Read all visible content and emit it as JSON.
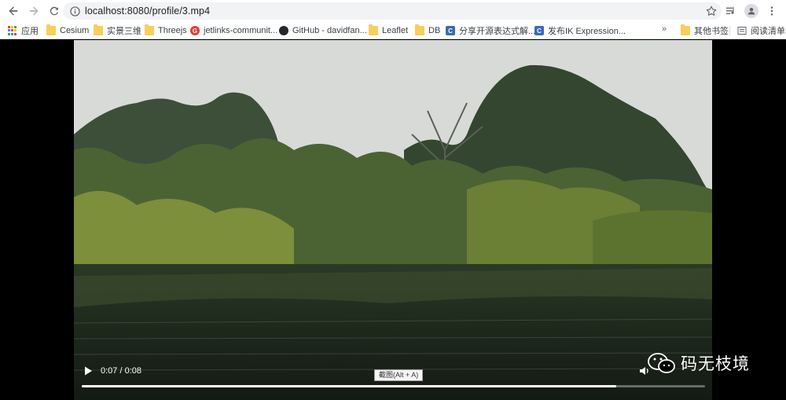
{
  "browser": {
    "url": "localhost:8080/profile/3.mp4"
  },
  "bookmarks": {
    "items": [
      {
        "label": "应用",
        "icon": "apps-icon"
      },
      {
        "label": "Cesium",
        "icon": "folder-icon"
      },
      {
        "label": "实景三维",
        "icon": "folder-icon"
      },
      {
        "label": "Threejs",
        "icon": "folder-icon"
      },
      {
        "label": "jetlinks-communit...",
        "icon": "google-icon"
      },
      {
        "label": "GitHub - davidfan...",
        "icon": "github-icon"
      },
      {
        "label": "Leaflet",
        "icon": "folder-icon"
      },
      {
        "label": "DB",
        "icon": "folder-icon"
      },
      {
        "label": "分享开源表达式解...",
        "icon": "csdn-icon"
      },
      {
        "label": "发布IK Expression...",
        "icon": "csdn-icon"
      }
    ],
    "overflow": "»",
    "other": "其他书签",
    "reading_list": "阅读清单"
  },
  "player": {
    "tooltip": "截图(Alt + A)",
    "time": "0:07 / 0:08",
    "progress": 0.857
  },
  "watermark": {
    "text": "码无枝境"
  },
  "colors": {
    "folder": "#f9ce5a",
    "toolbar_bg": "#ffffff",
    "omnibox_bg": "#f1f3f4"
  }
}
